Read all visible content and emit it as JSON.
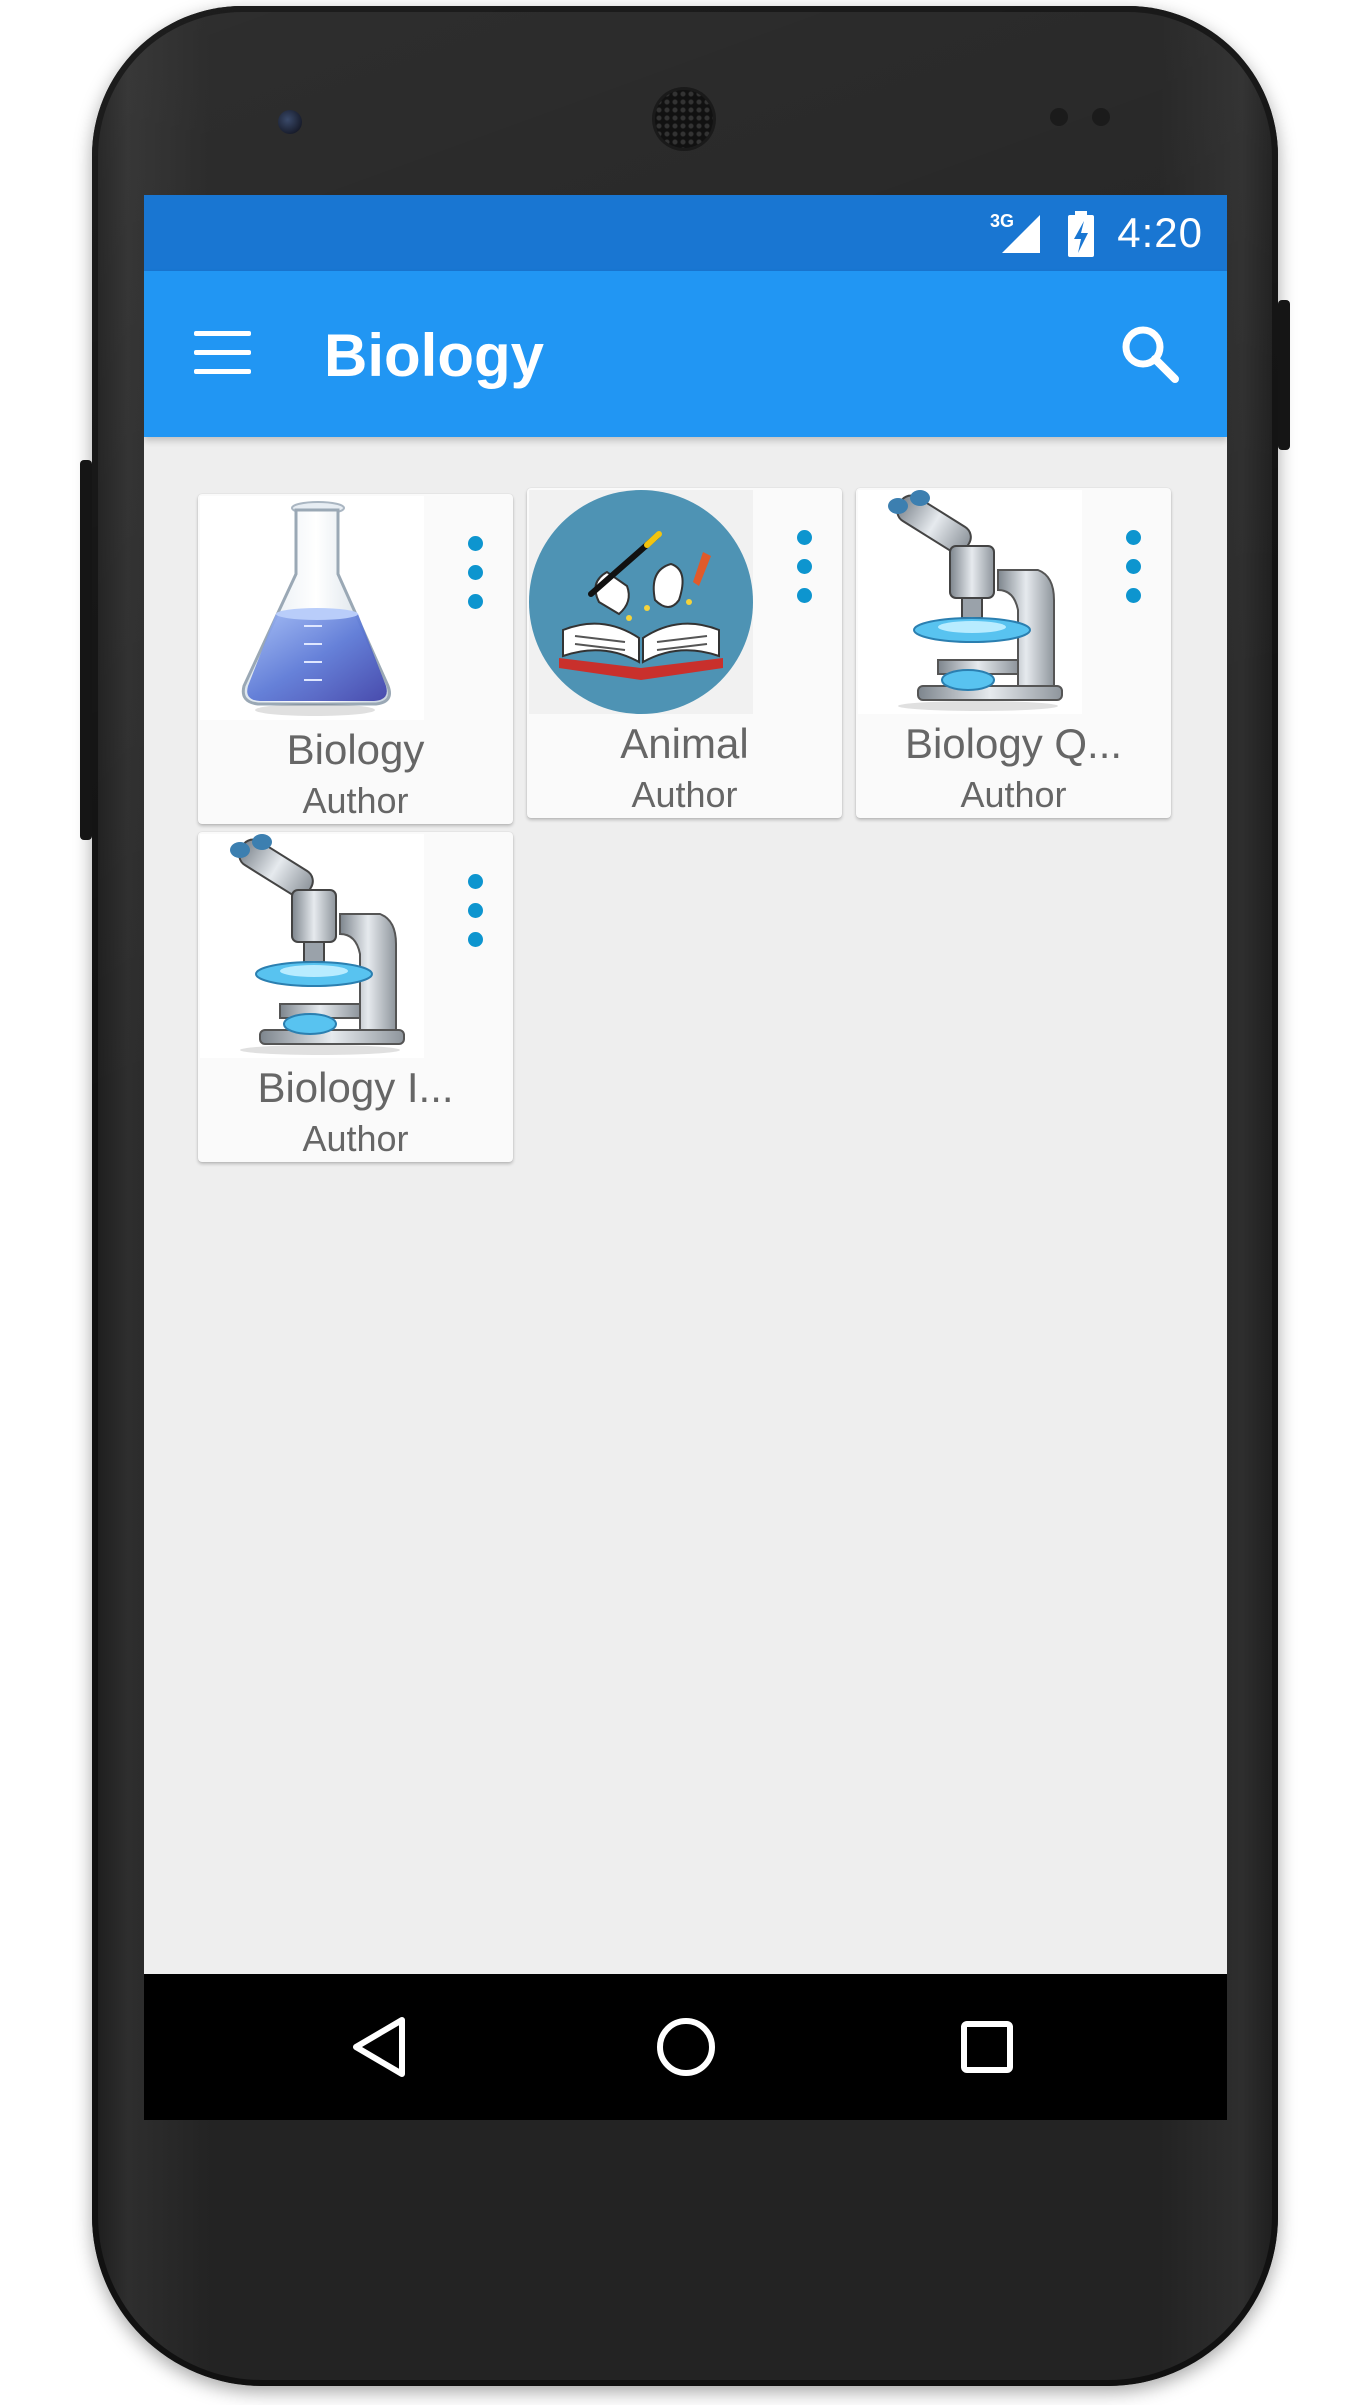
{
  "status_bar": {
    "network": "3G",
    "time": "4:20"
  },
  "app_bar": {
    "title": "Biology",
    "menu_icon": "hamburger-menu-icon",
    "search_icon": "search-icon"
  },
  "books": [
    {
      "title": "Biology",
      "author": "Author",
      "thumbnail": "flask-icon"
    },
    {
      "title": "Animal",
      "author": "Author",
      "thumbnail": "magic-book-icon"
    },
    {
      "title": "Biology Q...",
      "author": "Author",
      "thumbnail": "microscope-icon"
    },
    {
      "title": "Biology I...",
      "author": "Author",
      "thumbnail": "microscope-icon"
    }
  ],
  "nav_bar": {
    "back_icon": "back-triangle-icon",
    "home_icon": "home-circle-icon",
    "recents_icon": "recents-square-icon"
  },
  "colors": {
    "status_bar": "#1976d2",
    "app_bar": "#2196f3",
    "overflow_dots": "#0d95cf",
    "background": "#eeeeee"
  }
}
